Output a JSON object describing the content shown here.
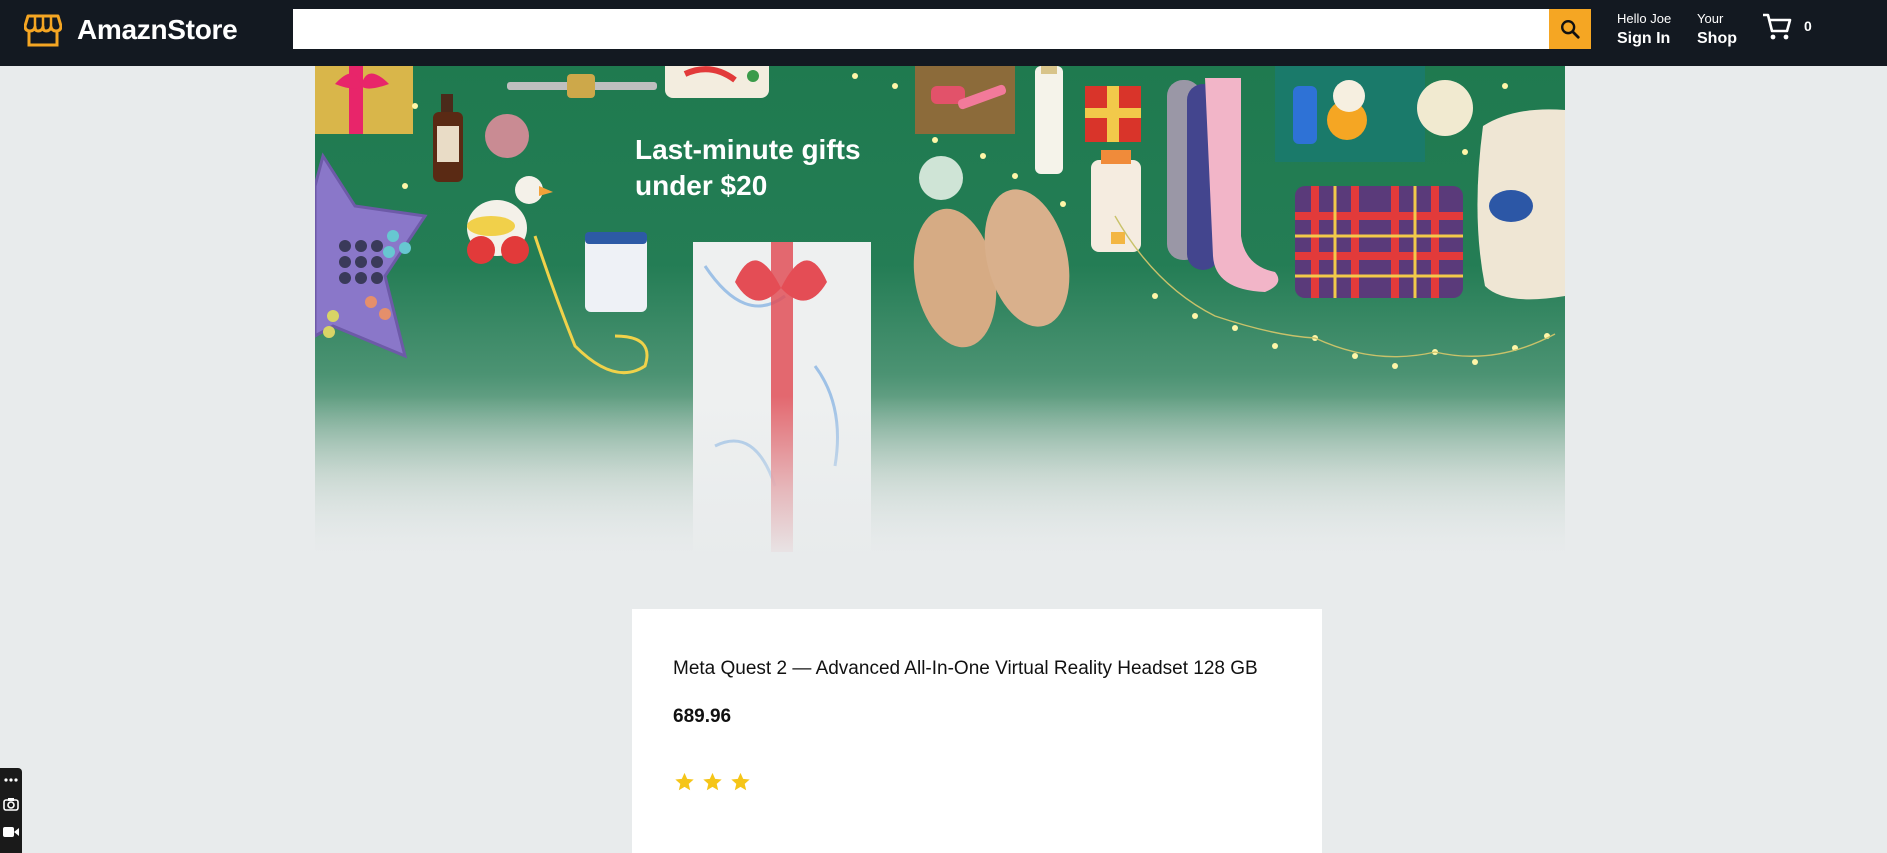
{
  "header": {
    "brand": "AmaznStore",
    "search": {
      "value": "",
      "placeholder": ""
    },
    "signin": {
      "line1": "Hello Joe",
      "line2": "Sign In"
    },
    "shop": {
      "line1": "Your",
      "line2": "Shop"
    },
    "cart_count": "0",
    "icons": [
      "store-icon",
      "search-icon",
      "cart-icon"
    ]
  },
  "banner": {
    "headline_line1": "Last-minute gifts",
    "headline_line2": "under $20"
  },
  "product": {
    "title": "Meta Quest 2 — Advanced All-In-One Virtual Reality Headset 128 GB",
    "price": "689.96",
    "rating": 3
  },
  "colors": {
    "header_bg": "#131921",
    "search_button": "#f5a623",
    "page_bg": "#e8ebec",
    "star": "#f5c518",
    "logo": "#f5a623"
  }
}
